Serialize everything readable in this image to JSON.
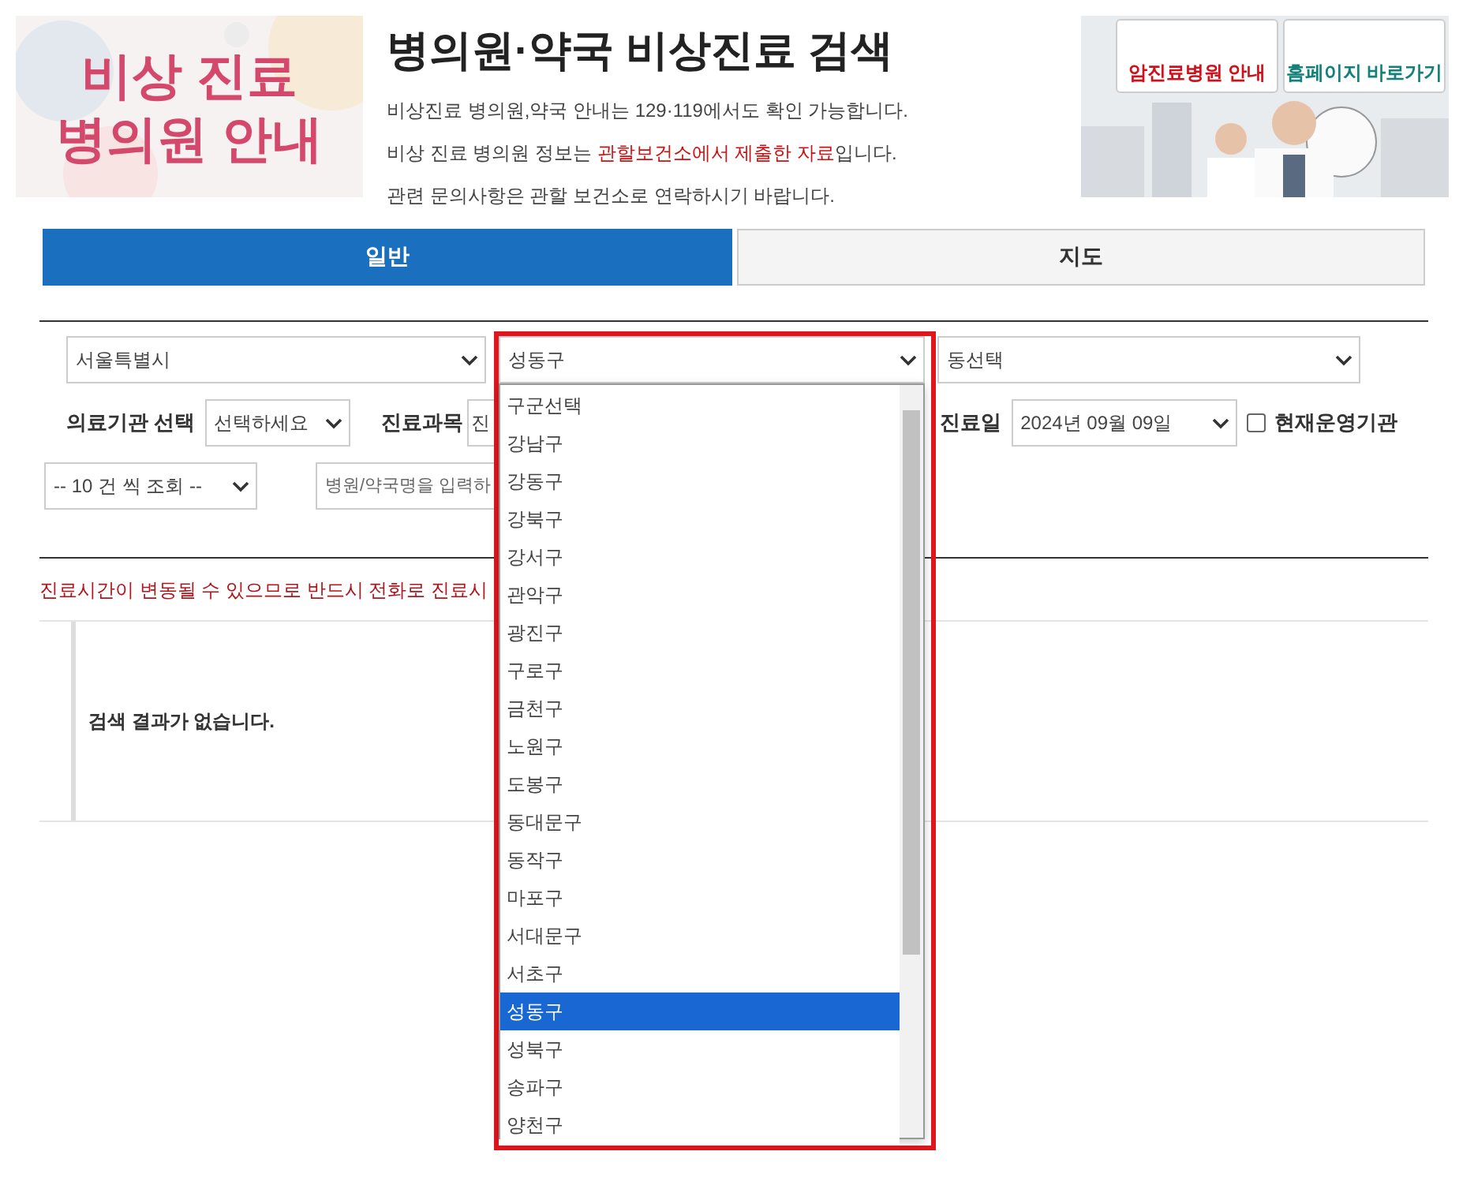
{
  "banner": {
    "lines": [
      "비상 진료",
      "병의원 안내"
    ]
  },
  "header": {
    "title": "병의원·약국 비상진료 검색",
    "notes": [
      [
        {
          "text": "비상진료 병의원,약국 안내는 129·119에서도 확인 가능합니다.",
          "kind": "plain"
        }
      ],
      [
        {
          "text": "비상 진료 병의원 정보는 ",
          "kind": "plain"
        },
        {
          "text": "관할보건소에서 제출한 자료",
          "kind": "emphasis"
        },
        {
          "text": "입니다.",
          "kind": "plain"
        }
      ],
      [
        {
          "text": "관련 문의사항은 관할 보건소로 연락하시기 바랍니다.",
          "kind": "plain"
        }
      ]
    ]
  },
  "ad": {
    "buttons": [
      "암진료병원 안내",
      "홈페이지 바로가기"
    ]
  },
  "tabs": [
    {
      "label": "일반",
      "selected": true
    },
    {
      "label": "지도",
      "selected": false
    }
  ],
  "region_selects": [
    "서울특별시",
    "성동구",
    "동선택"
  ],
  "filters": {
    "institution_label": "의료기관 선택",
    "institution_value": "선택하세요",
    "subject_label": "진료과목",
    "subject_value": "진",
    "date_label": "진료일",
    "date_value": "2024년 09월 09일",
    "open_now": {
      "label": "현재운영기관",
      "checked": false
    }
  },
  "page_size": "-- 10 건 씩 조회 --",
  "search": {
    "placeholder": "병원/약국명을 입력하"
  },
  "notice": "진료시간이 변동될 수 있으므로 반드시 전화로 진료시",
  "empty_message": "검색 결과가 없습니다.",
  "dropdown": {
    "options": [
      {
        "label": "구군선택",
        "selected": false
      },
      {
        "label": "강남구",
        "selected": false
      },
      {
        "label": "강동구",
        "selected": false
      },
      {
        "label": "강북구",
        "selected": false
      },
      {
        "label": "강서구",
        "selected": false
      },
      {
        "label": "관악구",
        "selected": false
      },
      {
        "label": "광진구",
        "selected": false
      },
      {
        "label": "구로구",
        "selected": false
      },
      {
        "label": "금천구",
        "selected": false
      },
      {
        "label": "노원구",
        "selected": false
      },
      {
        "label": "도봉구",
        "selected": false
      },
      {
        "label": "동대문구",
        "selected": false
      },
      {
        "label": "동작구",
        "selected": false
      },
      {
        "label": "마포구",
        "selected": false
      },
      {
        "label": "서대문구",
        "selected": false
      },
      {
        "label": "서초구",
        "selected": false
      },
      {
        "label": "성동구",
        "selected": true
      },
      {
        "label": "성북구",
        "selected": false
      },
      {
        "label": "송파구",
        "selected": false
      },
      {
        "label": "양천구",
        "selected": false
      }
    ]
  }
}
